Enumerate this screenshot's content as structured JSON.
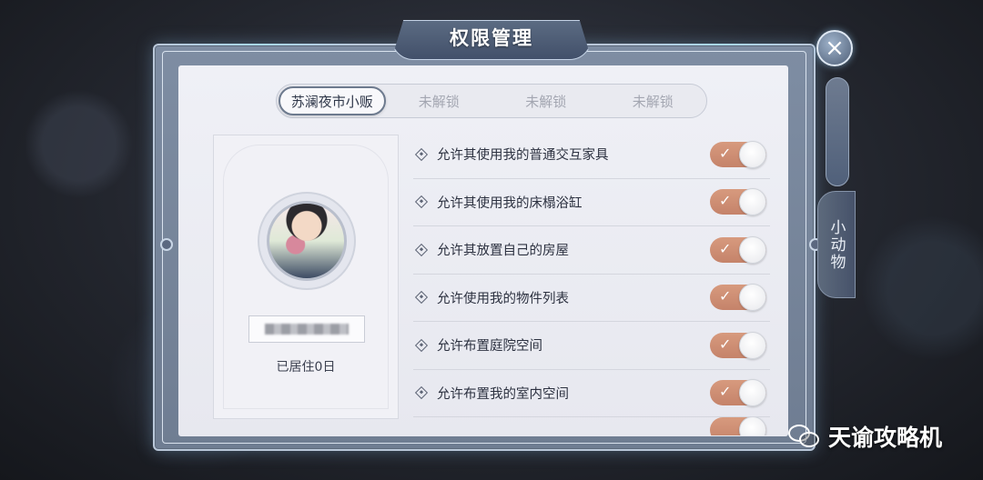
{
  "dialog": {
    "title": "权限管理",
    "close_symbol": "×"
  },
  "tabs": [
    {
      "label": "苏澜夜市小贩",
      "active": true
    },
    {
      "label": "未解锁",
      "active": false
    },
    {
      "label": "未解锁",
      "active": false
    },
    {
      "label": "未解锁",
      "active": false
    }
  ],
  "profile": {
    "residence": "已居住0日"
  },
  "permissions": [
    {
      "label": "允许其使用我的普通交互家具",
      "enabled": true
    },
    {
      "label": "允许其使用我的床榻浴缸",
      "enabled": true
    },
    {
      "label": "允许其放置自己的房屋",
      "enabled": true
    },
    {
      "label": "允许使用我的物件列表",
      "enabled": true
    },
    {
      "label": "允许布置庭院空间",
      "enabled": true
    },
    {
      "label": "允许布置我的室内空间",
      "enabled": true
    }
  ],
  "toggle_check": "✓",
  "side_tab": {
    "label": "小动物"
  },
  "watermark": {
    "text": "天谕攻略机",
    "icon": "wechat-icon"
  },
  "colors": {
    "toggle_on": "#c9876d",
    "frame": "#7e8da3",
    "panel": "#eeeff5"
  }
}
